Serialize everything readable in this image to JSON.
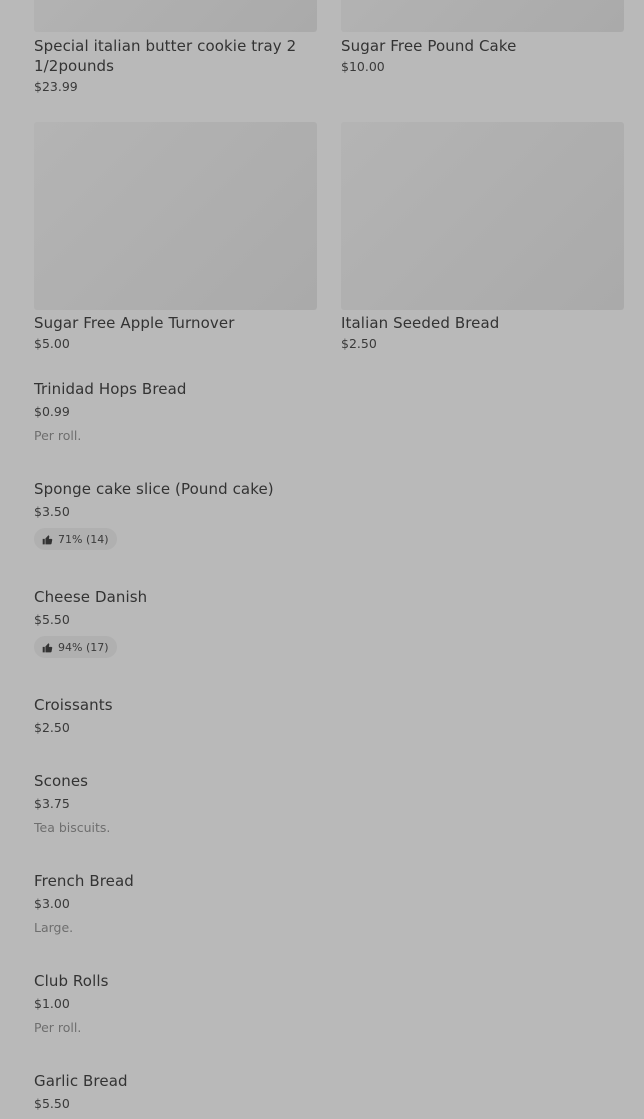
{
  "colors": {
    "background": "#b9b9b9",
    "image_placeholder": "#aeaeae",
    "text_primary": "#333333",
    "text_muted": "#6e6e6e",
    "rating_pill": "#b0b0b0"
  },
  "grid": [
    {
      "title": "Special  italian butter cookie tray 2 1/2pounds",
      "price": "$23.99"
    },
    {
      "title": "Sugar Free Pound Cake",
      "price": "$10.00"
    },
    {
      "title": "Sugar Free Apple Turnover",
      "price": "$5.00"
    },
    {
      "title": "Italian Seeded Bread",
      "price": "$2.50"
    }
  ],
  "list": [
    {
      "title": "Trinidad Hops Bread",
      "price": "$0.99",
      "desc": "Per roll."
    },
    {
      "title": "Sponge cake slice (Pound cake)",
      "price": "$3.50",
      "rating": "71% (14)",
      "rating_icon": "thumbs-up-icon"
    },
    {
      "title": "Cheese Danish",
      "price": "$5.50",
      "rating": "94% (17)",
      "rating_icon": "thumbs-up-icon"
    },
    {
      "title": "Croissants",
      "price": "$2.50"
    },
    {
      "title": "Scones",
      "price": "$3.75",
      "desc": "Tea biscuits."
    },
    {
      "title": "French Bread",
      "price": "$3.00",
      "desc": "Large."
    },
    {
      "title": "Club Rolls",
      "price": "$1.00",
      "desc": "Per roll."
    },
    {
      "title": "Garlic Bread",
      "price": "$5.50"
    }
  ]
}
